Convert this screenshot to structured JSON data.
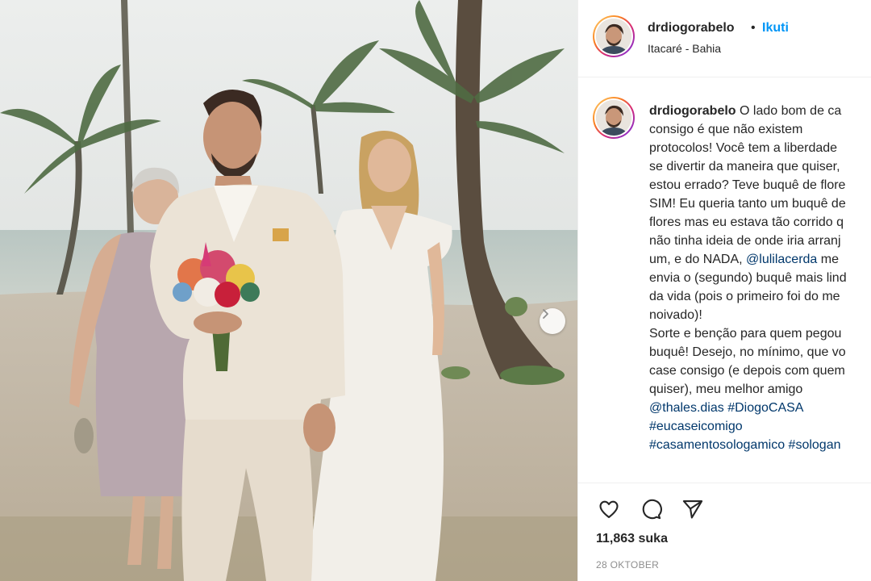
{
  "post": {
    "username": "drdiogorabelo",
    "follow_label": "Ikuti",
    "location": "Itacaré - Bahia",
    "caption": {
      "line1": "O lado bom de ca",
      "line2": "consigo é que não existem",
      "line3": "protocolos! Você tem a liberdade",
      "line4": "se divertir da maneira que quiser,",
      "line5": "estou errado? Teve buquê de flore",
      "line6": "SIM! Eu queria tanto um buquê de",
      "line7": "flores mas eu estava tão corrido q",
      "line8": "não tinha ideia de onde iria arranj",
      "line9_pre": "um, e do NADA, ",
      "line9_mention": "@lulilacerda",
      "line9_post": " me",
      "line10": "envia o (segundo) buquê mais lind",
      "line11": "da vida (pois o primeiro foi do me",
      "line12": "noivado)!",
      "line13": "Sorte e benção para quem pegou",
      "line14": "buquê! Desejo, no mínimo, que vo",
      "line15": "case consigo (e depois com quem",
      "line16": "quiser), meu melhor amigo",
      "mention2": "@thales.dias",
      "tag1": "#DiogoCASA",
      "tag2": "#eucaseicomigo",
      "tag3": "#casamentosologamico",
      "tag4": "#sologan"
    },
    "likes": "11,863 suka",
    "date": "28 OKTOBER"
  },
  "icons": {
    "like": "heart-icon",
    "comment": "comment-icon",
    "share": "send-icon",
    "next": "chevron-right-icon"
  },
  "colors": {
    "link": "#00376b",
    "follow": "#0095f6",
    "muted": "#8e8e8e"
  }
}
